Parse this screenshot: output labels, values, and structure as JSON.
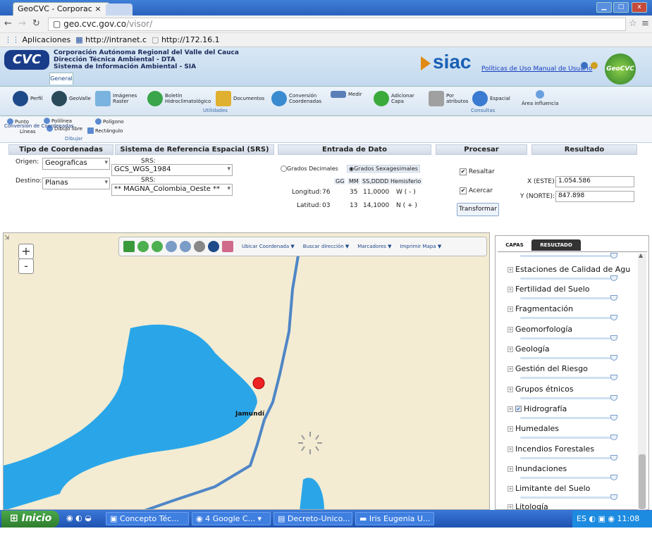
{
  "browser": {
    "tab_title": "GeoCVC - Corporac",
    "url_host": "geo.cvc.gov.co",
    "url_path": "/visor/",
    "bookmarks": [
      "Aplicaciones",
      "http://intranet.c",
      "http://172.16.1"
    ]
  },
  "header": {
    "logo": "CVC",
    "org_lines": [
      "Corporación Autónoma Regional del Valle del Cauca",
      "Dirección Técnica Ambiental - DTA",
      "Sistema de Información Ambiental - SIA"
    ],
    "general_tab": "General",
    "siac": "siac",
    "link_policy": "Políticas de Uso",
    "link_manual": "Manual de Usuario",
    "geocvc": "GeoCVC"
  },
  "toolbar": {
    "items": [
      "Perfil",
      "GeoValle",
      "Imágenes Raster",
      "Boletín Hidroclimatológico",
      "Documentos",
      "Conversión Coordenadas",
      "Medir",
      "Adicionar Capa",
      "Por atributos",
      "Espacial",
      "Área influencia"
    ],
    "group_utilidades": "Utilidades",
    "group_consultas": "Consultas"
  },
  "draw": {
    "punto": "Punto",
    "polilinea": "Polilínea",
    "poligono": "Polígono",
    "lineas": "Líneas",
    "dibujo_libre": "Dibujo libre",
    "rectangulo": "Rectángulo",
    "dibujar": "Dibujar",
    "conversion": "Conversión de Coordenadas"
  },
  "panel": {
    "h_tipo": "Tipo de Coordenadas",
    "h_srs": "Sistema de Referencia Espacial (SRS)",
    "h_entrada": "Entrada de Dato",
    "h_procesar": "Procesar",
    "h_resultado": "Resultado",
    "origen_label": "Origen:",
    "origen_value": "Geograficas",
    "srs_label": "SRS:",
    "srs_origen": "GCS_WGS_1984",
    "destino_label": "Destino:",
    "destino_value": "Planas",
    "srs_destino": "** MAGNA_Colombia_Oeste **",
    "grados_decimales": "Grados Decimales",
    "grados_sexagesimales": "Grados Sexagesimales",
    "col_gg": "GG",
    "col_mm": "MM",
    "col_ss": "SS,DDDD",
    "col_hem": "Hemisferio",
    "longitud_label": "Longitud:",
    "lon_gg": "76",
    "lon_mm": "35",
    "lon_ss": "11,0000",
    "lon_hem": "W ( - )",
    "latitud_label": "Latitud:",
    "lat_gg": "03",
    "lat_mm": "13",
    "lat_ss": "14,1000",
    "lat_hem": "N ( + )",
    "resaltar": "Resaltar",
    "acercar": "Acercar",
    "transformar": "Transformar",
    "x_label": "X (ESTE):",
    "x_value": "1.054.586",
    "y_label": "Y (NORTE):",
    "y_value": "847.898"
  },
  "map": {
    "zoom_in": "+",
    "zoom_out": "-",
    "ubicar": "Ubicar Coordenada ▼",
    "buscar": "Buscar dirección ▼",
    "marcadores": "Marcadores ▼",
    "imprimir": "Imprimir Mapa ▼",
    "place_label": "Jamundí"
  },
  "layers": {
    "tab_capas": "CAPAS",
    "tab_resultado": "RESULTADO",
    "items": [
      "Estaciones de Calidad de Agu",
      "Fertilidad del Suelo",
      "Fragmentación",
      "Geomorfología",
      "Geología",
      "Gestión del Riesgo",
      "Grupos étnicos",
      "Hidrografía",
      "Humedales",
      "Incendios Forestales",
      "Inundaciones",
      "Limitante del Suelo",
      "Litología"
    ],
    "checked": "Hidrografía"
  },
  "taskbar": {
    "start": "Inicio",
    "tasks": [
      "Concepto Téc...",
      "4 Google C...",
      "Decreto-Unico...",
      "Iris Eugenia U..."
    ],
    "lang": "ES",
    "time": "11:08 a.m."
  }
}
